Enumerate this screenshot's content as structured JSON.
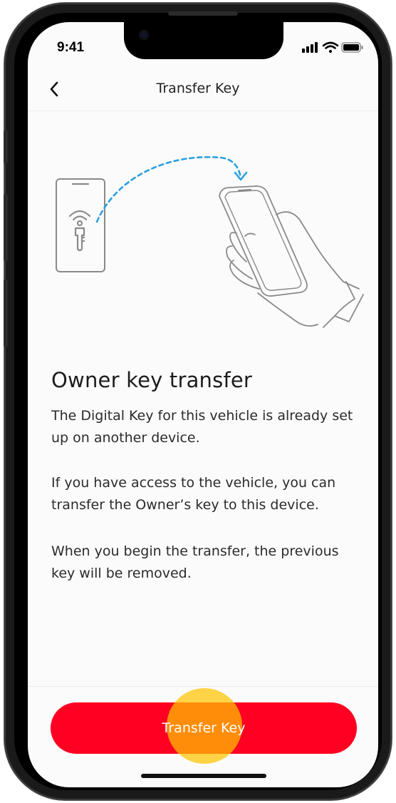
{
  "status_bar": {
    "time": "9:41",
    "icons": [
      "signal-icon",
      "wifi-icon",
      "battery-icon"
    ]
  },
  "header": {
    "title": "Transfer Key",
    "back_icon": "chevron-left-icon"
  },
  "content": {
    "heading": "Owner key transfer",
    "paragraphs": [
      "The Digital Key for this vehicle is already set up on another device.",
      "If you have access to the vehicle, you can transfer the Owner’s key to this device.",
      "When you begin the transfer, the previous key will be removed."
    ]
  },
  "footer": {
    "button_label": "Transfer Key"
  },
  "colors": {
    "accent": "#ff0022",
    "tap_indicator": "#ffc400",
    "transfer_arrow": "#2b9fe0"
  }
}
